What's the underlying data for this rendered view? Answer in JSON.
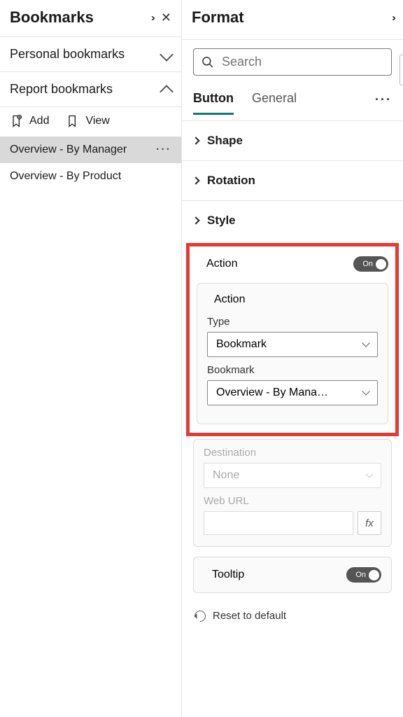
{
  "bookmarks_panel": {
    "title": "Bookmarks",
    "sections": {
      "personal": {
        "label": "Personal bookmarks",
        "expanded": false
      },
      "report": {
        "label": "Report bookmarks",
        "expanded": true
      }
    },
    "toolbar": {
      "add": "Add",
      "view": "View"
    },
    "items": [
      {
        "label": "Overview - By Manager",
        "selected": true
      },
      {
        "label": "Overview - By Product",
        "selected": false
      }
    ]
  },
  "format_panel": {
    "title": "Format",
    "search_placeholder": "Search",
    "tabs": [
      {
        "label": "Button",
        "active": true
      },
      {
        "label": "General",
        "active": false
      }
    ],
    "sections": {
      "shape": {
        "label": "Shape"
      },
      "rotation": {
        "label": "Rotation"
      },
      "style": {
        "label": "Style"
      },
      "action": {
        "label": "Action",
        "toggle_on": true,
        "toggle_label": "On",
        "inner_label": "Action",
        "type_label": "Type",
        "type_value": "Bookmark",
        "bookmark_label": "Bookmark",
        "bookmark_value": "Overview - By Mana…",
        "destination_label": "Destination",
        "destination_value": "None",
        "weburl_label": "Web URL",
        "fx_label": "fx"
      },
      "tooltip": {
        "label": "Tooltip",
        "toggle_on": true,
        "toggle_label": "On"
      }
    },
    "reset_label": "Reset to default"
  }
}
